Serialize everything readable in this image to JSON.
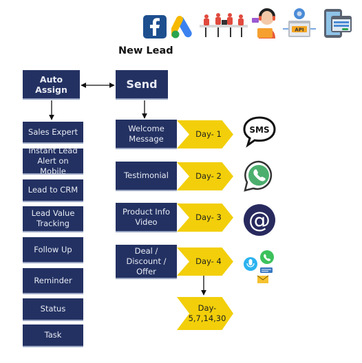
{
  "header": {
    "title": "New Lead",
    "icons": [
      "facebook-icon",
      "google-ads-icon",
      "team-meeting-icon",
      "support-agent-icon",
      "api-icon",
      "web-form-icon"
    ],
    "api_label": "API"
  },
  "flow": {
    "auto_assign": "Auto Assign",
    "send": "Send",
    "assign_items": [
      {
        "label": "Sales Expert"
      },
      {
        "label": "Instant Lead Alert on Mobile"
      },
      {
        "label": "Lead to CRM"
      },
      {
        "label": "Lead Value Tracking"
      },
      {
        "label": "Follow Up"
      },
      {
        "label": "Reminder"
      },
      {
        "label": "Status"
      },
      {
        "label": "Task"
      }
    ],
    "send_items": [
      {
        "label": "Welcome Message",
        "day": "Day- 1",
        "channel": "sms-icon",
        "channel_text": "SMS"
      },
      {
        "label": "Testimonial",
        "day": "Day- 2",
        "channel": "whatsapp-icon"
      },
      {
        "label": "Product Info Video",
        "day": "Day- 3",
        "channel": "email-at-icon",
        "channel_text": "@"
      },
      {
        "label": "Deal / Discount / Offer",
        "day": "Day- 4",
        "channel": "multi-channel-icon"
      }
    ],
    "followup_day": "Day- 5,7,14,30"
  },
  "colors": {
    "navy": "#233162",
    "yellow": "#f2cf0a",
    "whatsapp_green": "#4caf6e"
  }
}
